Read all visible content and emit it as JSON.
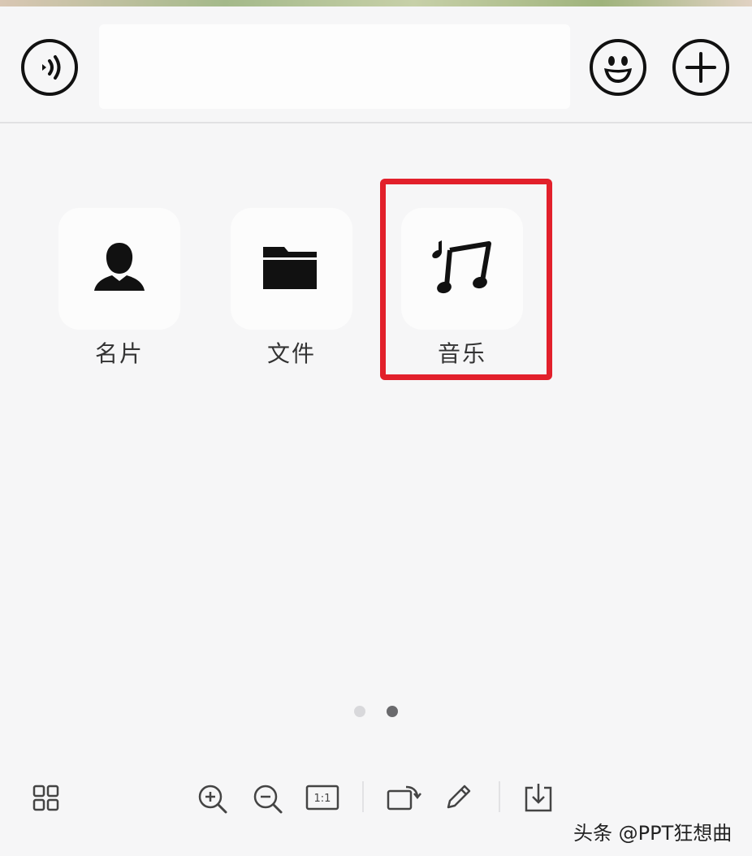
{
  "input_bar": {
    "voice_icon": "voice-icon",
    "text_value": "",
    "emoji_icon": "emoji-icon",
    "plus_icon": "plus-icon"
  },
  "actions": [
    {
      "label": "名片",
      "icon": "contact-card-icon"
    },
    {
      "label": "文件",
      "icon": "folder-icon"
    },
    {
      "label": "音乐",
      "icon": "music-icon"
    }
  ],
  "highlight_color": "#e2202b",
  "pager": {
    "total": 2,
    "current": 2
  },
  "toolbar": {
    "icons": [
      "grid-icon",
      "zoom-in-icon",
      "zoom-out-icon",
      "actual-size-icon",
      "rotate-icon",
      "edit-pencil-icon",
      "download-icon"
    ],
    "actual_size_label": "1:1"
  },
  "watermark": "头条 @PPT狂想曲"
}
